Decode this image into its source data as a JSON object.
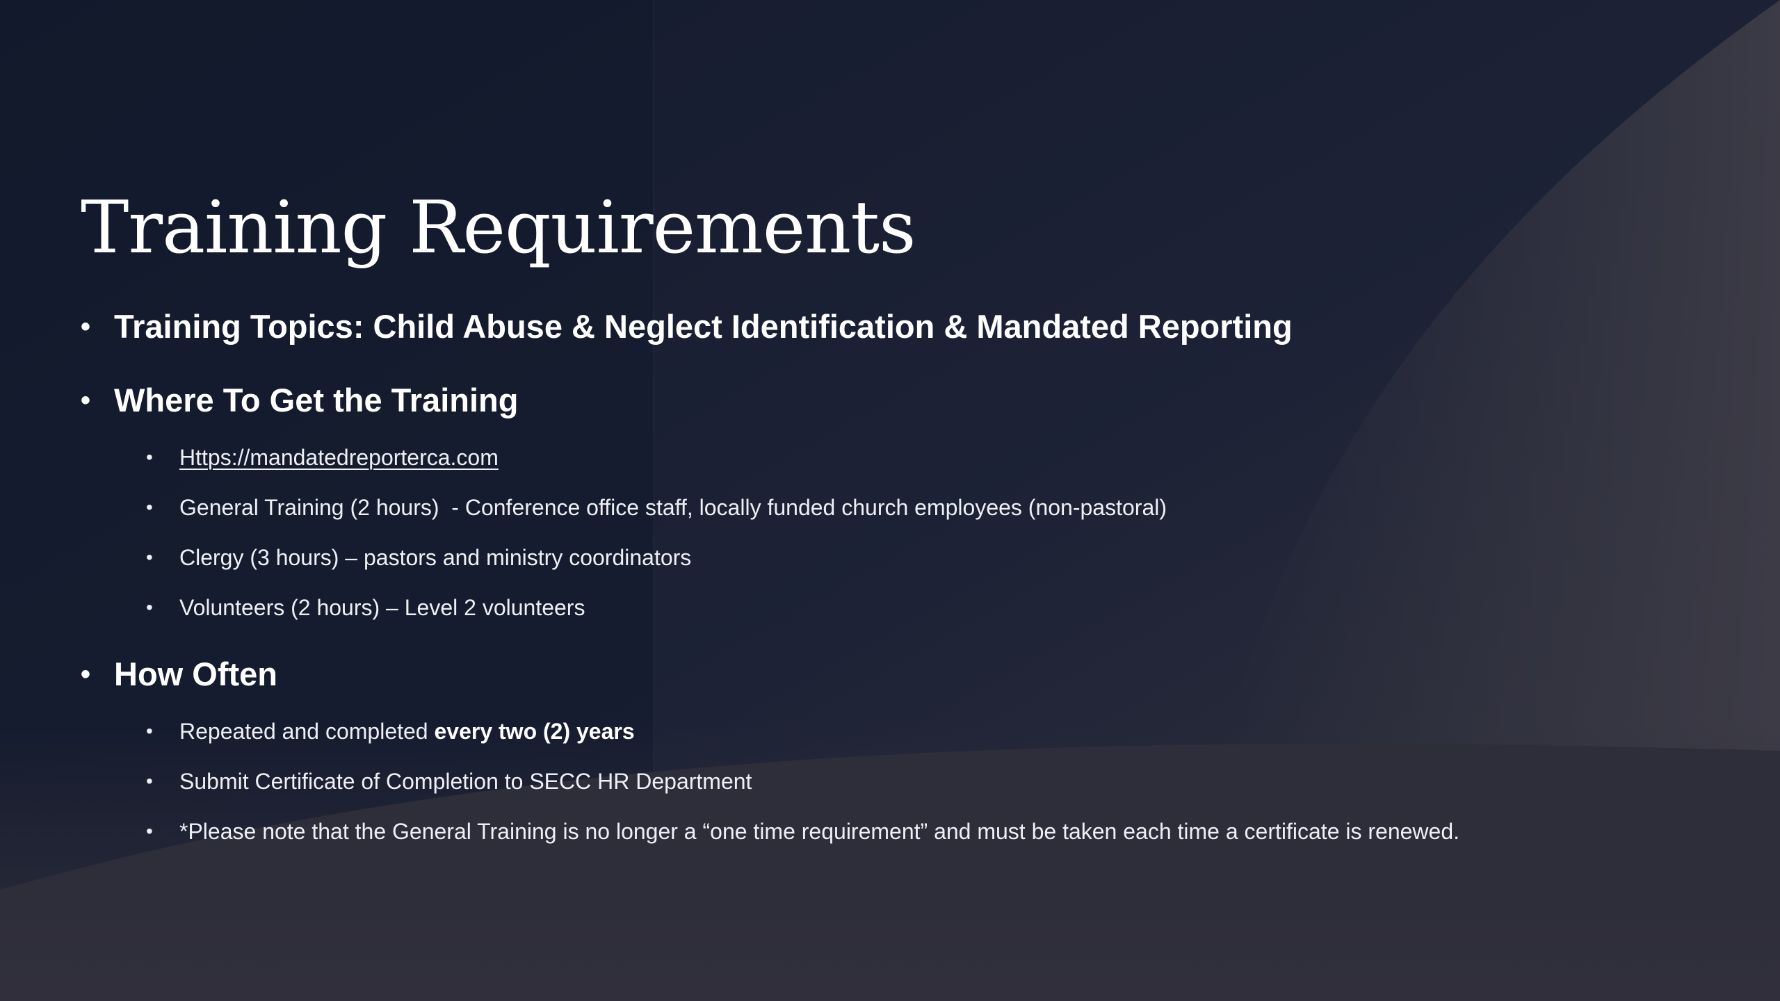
{
  "slide": {
    "title": "Training Requirements",
    "bullet_char": "•",
    "topics": {
      "label": "Training Topics: Child Abuse & Neglect Identification & Mandated Reporting"
    },
    "where": {
      "heading": "Where To Get the Training",
      "link": "Https://mandatedreporterca.com",
      "items": [
        "General Training (2 hours)  - Conference office staff, locally funded church employees (non-pastoral)",
        "Clergy (3 hours) – pastors and ministry coordinators",
        "Volunteers (2 hours) – Level 2 volunteers"
      ]
    },
    "how_often": {
      "heading": "How Often",
      "repeat_prefix": "Repeated and completed ",
      "repeat_bold": "every two (2) years",
      "items": [
        "Submit Certificate of Completion to SECC HR Department",
        "*Please note that the General Training is no longer a “one time requirement” and must be taken each time a certificate is renewed."
      ]
    }
  },
  "colors": {
    "background_dark": "#171b2e",
    "background_light": "#34343f",
    "text": "#ffffff"
  }
}
